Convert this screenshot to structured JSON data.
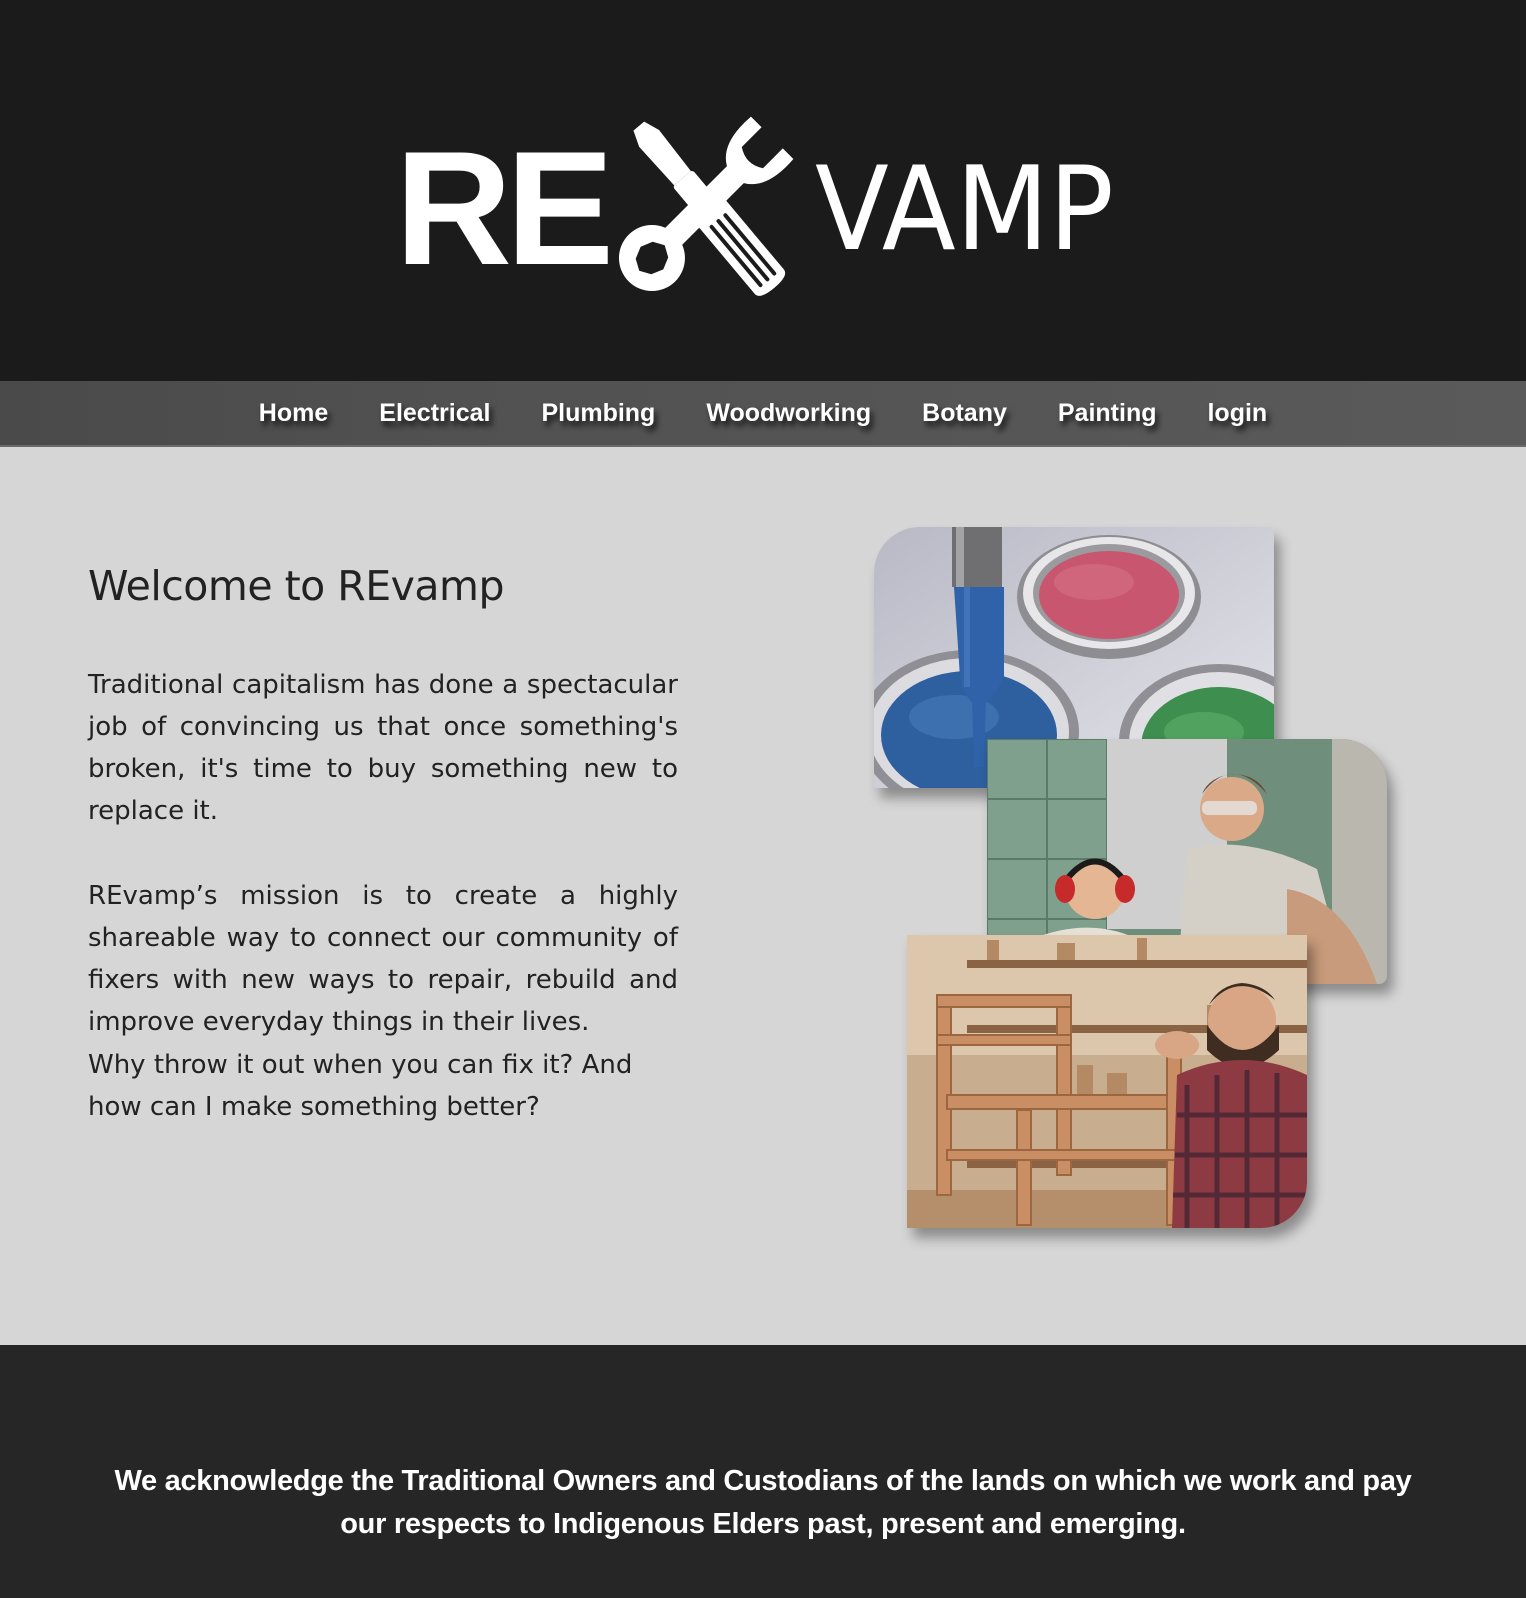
{
  "header": {
    "logo": {
      "text_left": "RE",
      "text_right": "VAMP",
      "icon": "wrench-screwdriver-icon"
    }
  },
  "nav": {
    "items": [
      {
        "label": "Home"
      },
      {
        "label": "Electrical"
      },
      {
        "label": "Plumbing"
      },
      {
        "label": "Woodworking"
      },
      {
        "label": "Botany"
      },
      {
        "label": "Painting"
      },
      {
        "label": "login"
      }
    ]
  },
  "main": {
    "heading": "Welcome to REvamp",
    "paragraphs": [
      "Traditional capitalism has done a spectacular job of convincing us that once something's broken, it's time to buy something new to replace it.",
      "REvamp’s mission is to create a highly shareable way to connect our community of fixers with new ways to repair, rebuild and improve everyday things in their lives.",
      "Why throw it out when you can fix it? And how can I make something better?"
    ],
    "photos": [
      {
        "name": "paint-cans-photo"
      },
      {
        "name": "workshop-kids-photo"
      },
      {
        "name": "woodworker-photo"
      }
    ]
  },
  "footer": {
    "acknowledgement": "We acknowledge the Traditional Owners and Custodians of the lands on which we work and pay our respects to Indigenous Elders past, present and emerging."
  },
  "colors": {
    "header_bg": "#1b1b1c",
    "nav_bg": "#555555",
    "main_bg": "#d6d6d6",
    "footer_bg": "#262626",
    "text_dark": "#222222",
    "text_light": "#ffffff"
  }
}
